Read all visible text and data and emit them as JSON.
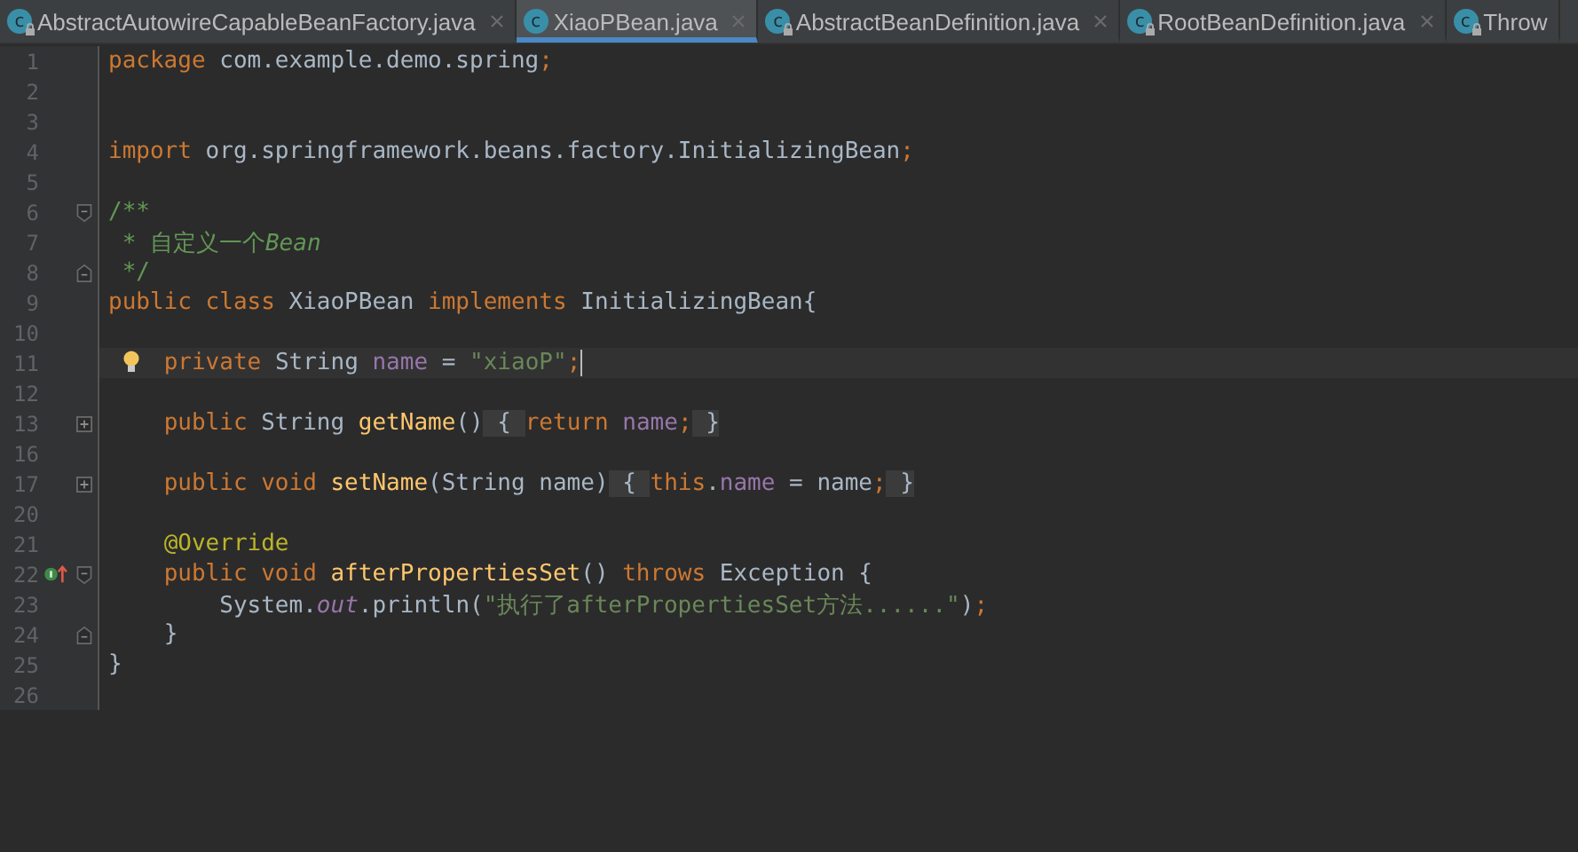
{
  "tabs": [
    {
      "label": "AbstractAutowireCapableBeanFactory.java",
      "badge": "c",
      "locked": true,
      "closable": true,
      "selected": false
    },
    {
      "label": "XiaoPBean.java",
      "badge": "c",
      "locked": false,
      "closable": true,
      "selected": true
    },
    {
      "label": "AbstractBeanDefinition.java",
      "badge": "c",
      "locked": true,
      "closable": true,
      "selected": false
    },
    {
      "label": "RootBeanDefinition.java",
      "badge": "c",
      "locked": true,
      "closable": true,
      "selected": false
    },
    {
      "label": "Throw",
      "badge": "c",
      "locked": true,
      "closable": false,
      "selected": false
    }
  ],
  "lines": [
    {
      "number": "1",
      "tokens": [
        {
          "kind": "keyword",
          "text": "package"
        },
        {
          "kind": "plain",
          "text": " com.example.demo.spring"
        },
        {
          "kind": "keyword",
          "text": ";"
        }
      ]
    },
    {
      "number": "2"
    },
    {
      "number": "3"
    },
    {
      "number": "4",
      "tokens": [
        {
          "kind": "keyword",
          "text": "import"
        },
        {
          "kind": "plain",
          "text": " org.springframework.beans.factory.InitializingBean"
        },
        {
          "kind": "keyword",
          "text": ";"
        }
      ]
    },
    {
      "number": "5"
    },
    {
      "number": "6",
      "fold_start": true,
      "tokens": [
        {
          "kind": "comment",
          "text": "/**"
        }
      ]
    },
    {
      "number": "7",
      "tokens": [
        {
          "kind": "comment",
          "text": " * 自定义一个"
        },
        {
          "kind": "doc-italic",
          "text": "Bean"
        }
      ]
    },
    {
      "number": "8",
      "fold_end": true,
      "tokens": [
        {
          "kind": "comment",
          "text": " */"
        }
      ]
    },
    {
      "number": "9",
      "tokens": [
        {
          "kind": "keyword",
          "text": "public class "
        },
        {
          "kind": "plain",
          "text": "XiaoPBean"
        },
        {
          "kind": "keyword",
          "text": " implements "
        },
        {
          "kind": "plain",
          "text": "InitializingBean{"
        }
      ]
    },
    {
      "number": "10"
    },
    {
      "number": "11",
      "current": true,
      "bulb": true,
      "tokens": [
        {
          "kind": "keyword",
          "text": "    private "
        },
        {
          "kind": "plain",
          "text": "String "
        },
        {
          "kind": "field",
          "text": "name"
        },
        {
          "kind": "plain",
          "text": " = "
        },
        {
          "kind": "string",
          "text": "\"xiaoP\""
        },
        {
          "kind": "keyword",
          "text": ";"
        }
      ]
    },
    {
      "number": "12"
    },
    {
      "number": "13",
      "collapsed": true,
      "tokens": [
        {
          "kind": "keyword",
          "text": "    public "
        },
        {
          "kind": "plain",
          "text": "String "
        },
        {
          "kind": "method",
          "text": "getName"
        },
        {
          "kind": "plain",
          "text": "()"
        },
        {
          "kind": "folded",
          "text": " { "
        },
        {
          "kind": "keyword",
          "text": "return "
        },
        {
          "kind": "field",
          "text": "name"
        },
        {
          "kind": "keyword",
          "text": ";"
        },
        {
          "kind": "folded",
          "text": " }"
        }
      ]
    },
    {
      "number": "16"
    },
    {
      "number": "17",
      "collapsed": true,
      "tokens": [
        {
          "kind": "keyword",
          "text": "    public void "
        },
        {
          "kind": "method",
          "text": "setName"
        },
        {
          "kind": "plain",
          "text": "(String name)"
        },
        {
          "kind": "folded",
          "text": " { "
        },
        {
          "kind": "keyword",
          "text": "this"
        },
        {
          "kind": "plain",
          "text": "."
        },
        {
          "kind": "field",
          "text": "name"
        },
        {
          "kind": "plain",
          "text": " = name"
        },
        {
          "kind": "keyword",
          "text": ";"
        },
        {
          "kind": "folded",
          "text": " }"
        }
      ]
    },
    {
      "number": "20"
    },
    {
      "number": "21",
      "tokens": [
        {
          "kind": "annotation",
          "text": "    @Override"
        }
      ]
    },
    {
      "number": "22",
      "fold_start": true,
      "overrides": true,
      "tokens": [
        {
          "kind": "keyword",
          "text": "    public void "
        },
        {
          "kind": "method",
          "text": "afterPropertiesSet"
        },
        {
          "kind": "plain",
          "text": "() "
        },
        {
          "kind": "keyword",
          "text": "throws "
        },
        {
          "kind": "plain",
          "text": "Exception {"
        }
      ]
    },
    {
      "number": "23",
      "tokens": [
        {
          "kind": "plain",
          "text": "        System."
        },
        {
          "kind": "static",
          "text": "out"
        },
        {
          "kind": "plain",
          "text": ".println("
        },
        {
          "kind": "string",
          "text": "\"执行了afterPropertiesSet方法......\""
        },
        {
          "kind": "plain",
          "text": ")"
        },
        {
          "kind": "keyword",
          "text": ";"
        }
      ]
    },
    {
      "number": "24",
      "fold_end": true,
      "tokens": [
        {
          "kind": "plain",
          "text": "    }"
        }
      ]
    },
    {
      "number": "25",
      "tokens": [
        {
          "kind": "plain",
          "text": "}"
        }
      ]
    },
    {
      "number": "26"
    }
  ]
}
